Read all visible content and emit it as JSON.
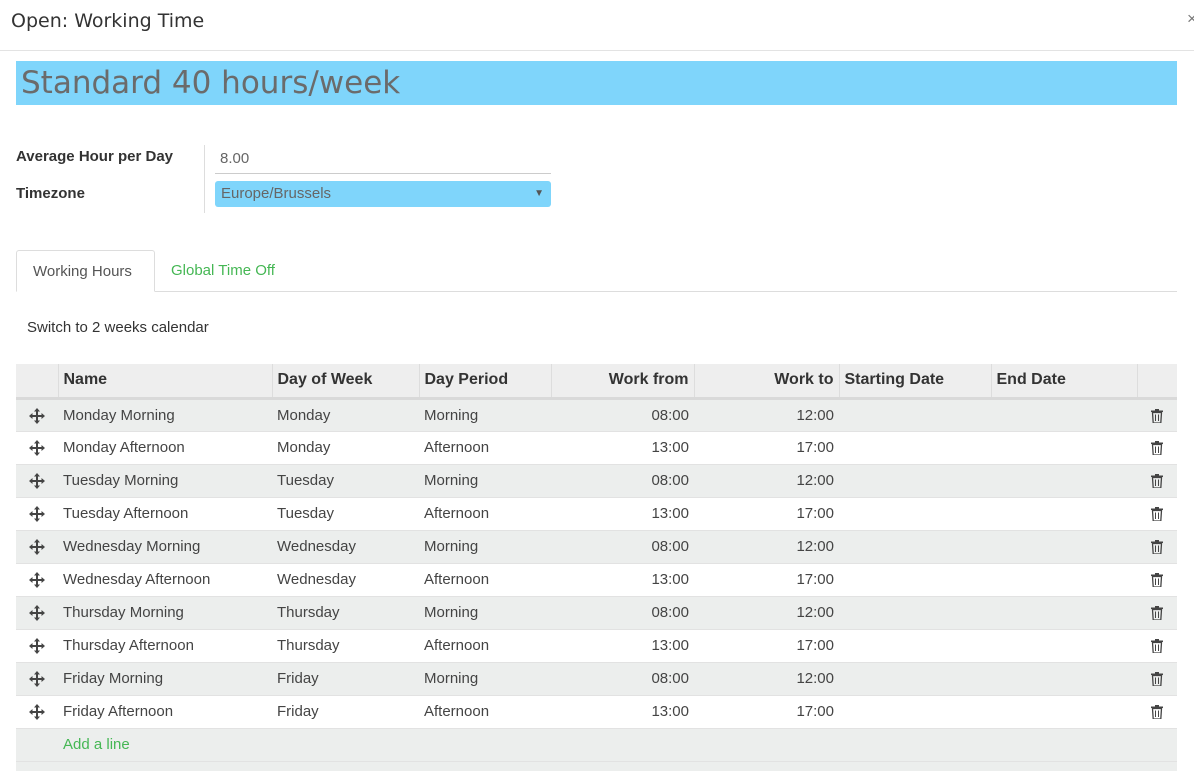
{
  "dialog": {
    "title": "Open: Working Time",
    "close_label": "×"
  },
  "record": {
    "name": "Standard 40 hours/week"
  },
  "fields": {
    "avg_hour_label": "Average Hour per Day",
    "avg_hour_value": "8.00",
    "timezone_label": "Timezone",
    "timezone_value": "Europe/Brussels"
  },
  "tabs": [
    {
      "label": "Working Hours",
      "active": true
    },
    {
      "label": "Global Time Off",
      "active": false
    }
  ],
  "switch_label": "Switch to 2 weeks calendar",
  "table": {
    "columns": [
      "Name",
      "Day of Week",
      "Day Period",
      "Work from",
      "Work to",
      "Starting Date",
      "End Date"
    ],
    "rows": [
      {
        "name": "Monday Morning",
        "day": "Monday",
        "period": "Morning",
        "from": "08:00",
        "to": "12:00",
        "start": "",
        "end": ""
      },
      {
        "name": "Monday Afternoon",
        "day": "Monday",
        "period": "Afternoon",
        "from": "13:00",
        "to": "17:00",
        "start": "",
        "end": ""
      },
      {
        "name": "Tuesday Morning",
        "day": "Tuesday",
        "period": "Morning",
        "from": "08:00",
        "to": "12:00",
        "start": "",
        "end": ""
      },
      {
        "name": "Tuesday Afternoon",
        "day": "Tuesday",
        "period": "Afternoon",
        "from": "13:00",
        "to": "17:00",
        "start": "",
        "end": ""
      },
      {
        "name": "Wednesday Morning",
        "day": "Wednesday",
        "period": "Morning",
        "from": "08:00",
        "to": "12:00",
        "start": "",
        "end": ""
      },
      {
        "name": "Wednesday Afternoon",
        "day": "Wednesday",
        "period": "Afternoon",
        "from": "13:00",
        "to": "17:00",
        "start": "",
        "end": ""
      },
      {
        "name": "Thursday Morning",
        "day": "Thursday",
        "period": "Morning",
        "from": "08:00",
        "to": "12:00",
        "start": "",
        "end": ""
      },
      {
        "name": "Thursday Afternoon",
        "day": "Thursday",
        "period": "Afternoon",
        "from": "13:00",
        "to": "17:00",
        "start": "",
        "end": ""
      },
      {
        "name": "Friday Morning",
        "day": "Friday",
        "period": "Morning",
        "from": "08:00",
        "to": "12:00",
        "start": "",
        "end": ""
      },
      {
        "name": "Friday Afternoon",
        "day": "Friday",
        "period": "Afternoon",
        "from": "13:00",
        "to": "17:00",
        "start": "",
        "end": ""
      }
    ],
    "add_line_label": "Add a line"
  },
  "colors": {
    "highlight": "#7fd5fb",
    "link_green": "#45b754",
    "row_alt": "#eceeed"
  }
}
